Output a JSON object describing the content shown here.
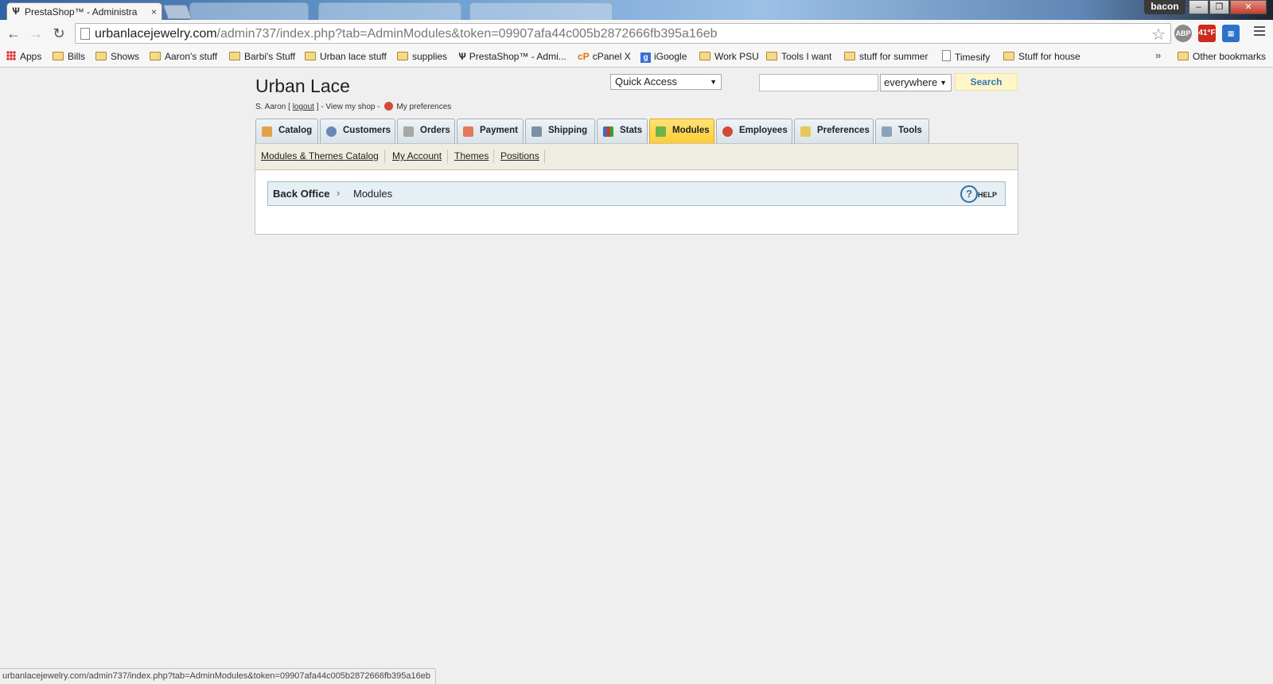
{
  "browser": {
    "active_tab_title": "PrestaShop™ - Administra",
    "tab_close": "×",
    "profile": "bacon",
    "url_host": "urbanlacejewelry.com",
    "url_path": "/admin737/index.php?tab=AdminModules&token=09907afa44c005b2872666fb395a16eb",
    "weather": "41°F",
    "status_url": "urbanlacejewelry.com/admin737/index.php?tab=AdminModules&token=09907afa44c005b2872666fb395a16eb"
  },
  "bookmarks": {
    "items": [
      "Apps",
      "Bills",
      "Shows",
      "Aaron's stuff",
      "Barbi's Stuff",
      "Urban lace stuff",
      "supplies",
      "PrestaShop™ - Admi...",
      "cPanel X",
      "iGoogle",
      "Work PSU",
      "Tools I want",
      "stuff for summer",
      "Timesify",
      "Stuff for house"
    ],
    "overflow": "»",
    "other": "Other bookmarks"
  },
  "header": {
    "shop_name": "Urban Lace",
    "user": "S. Aaron [",
    "logout": "logout",
    "after_logout": "] - View my shop -",
    "my_preferences": "My preferences"
  },
  "quick_access": {
    "label": "Quick Access"
  },
  "search": {
    "scope": "everywhere",
    "button": "Search"
  },
  "nav": {
    "tabs": [
      "Catalog",
      "Customers",
      "Orders",
      "Payment",
      "Shipping",
      "Stats",
      "Modules",
      "Employees",
      "Preferences",
      "Tools"
    ],
    "active": "Modules"
  },
  "subnav": {
    "items": [
      "Modules & Themes Catalog",
      "My Account",
      "Themes",
      "Positions"
    ]
  },
  "breadcrumb": {
    "root": "Back Office",
    "current": "Modules",
    "help": "HELP"
  },
  "colors": {
    "accent": "#ffcc33",
    "link": "#3376b8"
  }
}
